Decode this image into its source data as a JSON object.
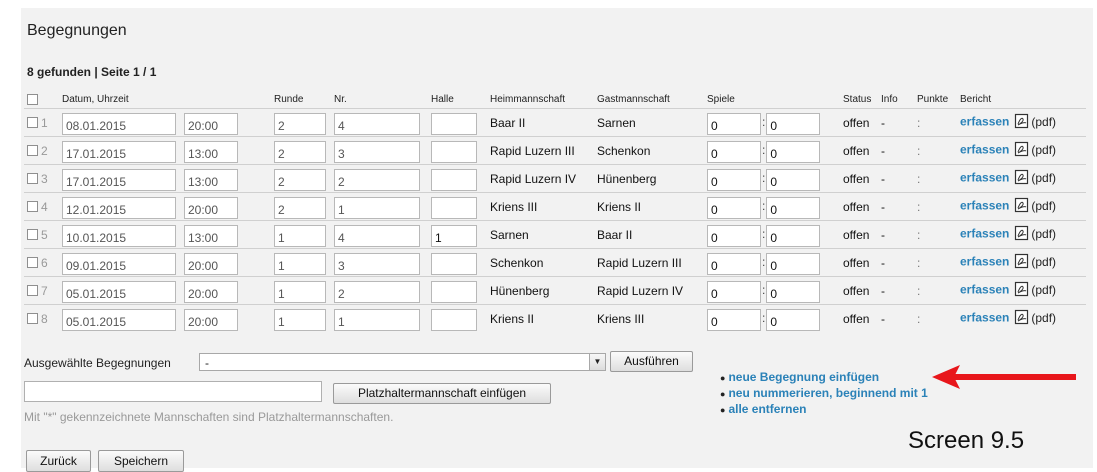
{
  "header": {
    "title": "Begegnungen",
    "found": "8 gefunden | Seite 1 / 1"
  },
  "columns": {
    "datum": "Datum, Uhrzeit",
    "runde": "Runde",
    "nr": "Nr.",
    "halle": "Halle",
    "heim": "Heimmannschaft",
    "gast": "Gastmannschaft",
    "spiele": "Spiele",
    "status": "Status",
    "info": "Info",
    "punkte": "Punkte",
    "bericht": "Bericht"
  },
  "rows": [
    {
      "num": "1",
      "date": "08.01.2015",
      "time": "20:00",
      "runde": "2",
      "nr": "4",
      "halle": "",
      "heim": "Baar II",
      "gast": "Sarnen",
      "spiele_a": "0",
      "spiele_b": "0",
      "status": "offen",
      "info": "-",
      "punkte": ":",
      "bericht": "erfassen",
      "pdf": "(pdf)"
    },
    {
      "num": "2",
      "date": "17.01.2015",
      "time": "13:00",
      "runde": "2",
      "nr": "3",
      "halle": "",
      "heim": "Rapid Luzern III",
      "gast": "Schenkon",
      "spiele_a": "0",
      "spiele_b": "0",
      "status": "offen",
      "info": "-",
      "punkte": ":",
      "bericht": "erfassen",
      "pdf": "(pdf)"
    },
    {
      "num": "3",
      "date": "17.01.2015",
      "time": "13:00",
      "runde": "2",
      "nr": "2",
      "halle": "",
      "heim": "Rapid Luzern IV",
      "gast": "Hünenberg",
      "spiele_a": "0",
      "spiele_b": "0",
      "status": "offen",
      "info": "-",
      "punkte": ":",
      "bericht": "erfassen",
      "pdf": "(pdf)"
    },
    {
      "num": "4",
      "date": "12.01.2015",
      "time": "20:00",
      "runde": "2",
      "nr": "1",
      "halle": "",
      "heim": "Kriens III",
      "gast": "Kriens II",
      "spiele_a": "0",
      "spiele_b": "0",
      "status": "offen",
      "info": "-",
      "punkte": ":",
      "bericht": "erfassen",
      "pdf": "(pdf)"
    },
    {
      "num": "5",
      "date": "10.01.2015",
      "time": "13:00",
      "runde": "1",
      "nr": "4",
      "halle": "1",
      "heim": "Sarnen",
      "gast": "Baar II",
      "spiele_a": "0",
      "spiele_b": "0",
      "status": "offen",
      "info": "-",
      "punkte": ":",
      "bericht": "erfassen",
      "pdf": "(pdf)"
    },
    {
      "num": "6",
      "date": "09.01.2015",
      "time": "20:00",
      "runde": "1",
      "nr": "3",
      "halle": "",
      "heim": "Schenkon",
      "gast": "Rapid Luzern III",
      "spiele_a": "0",
      "spiele_b": "0",
      "status": "offen",
      "info": "-",
      "punkte": ":",
      "bericht": "erfassen",
      "pdf": "(pdf)"
    },
    {
      "num": "7",
      "date": "05.01.2015",
      "time": "20:00",
      "runde": "1",
      "nr": "2",
      "halle": "",
      "heim": "Hünenberg",
      "gast": "Rapid Luzern IV",
      "spiele_a": "0",
      "spiele_b": "0",
      "status": "offen",
      "info": "-",
      "punkte": ":",
      "bericht": "erfassen",
      "pdf": "(pdf)"
    },
    {
      "num": "8",
      "date": "05.01.2015",
      "time": "20:00",
      "runde": "1",
      "nr": "1",
      "halle": "",
      "heim": "Kriens II",
      "gast": "Kriens III",
      "spiele_a": "0",
      "spiele_b": "0",
      "status": "offen",
      "info": "-",
      "punkte": ":",
      "bericht": "erfassen",
      "pdf": "(pdf)"
    }
  ],
  "bulk": {
    "label": "Ausgewählte Begegnungen",
    "selected": "-",
    "execute": "Ausführen"
  },
  "placeholder": {
    "button": "Platzhaltermannschaft einfügen",
    "note": "Mit \"*\" gekennzeichnete Mannschaften sind Platzhaltermannschaften."
  },
  "actions": [
    "neue Begegnung einfügen",
    "neu nummerieren, beginnend mit 1",
    "alle entfernen"
  ],
  "footer": {
    "back": "Zurück",
    "save": "Speichern"
  },
  "annotation": {
    "label": "Screen 9.5",
    "arrow_color": "#e8161b"
  },
  "colors": {
    "link": "#2b82b8",
    "panel": "#f2f2f2"
  }
}
